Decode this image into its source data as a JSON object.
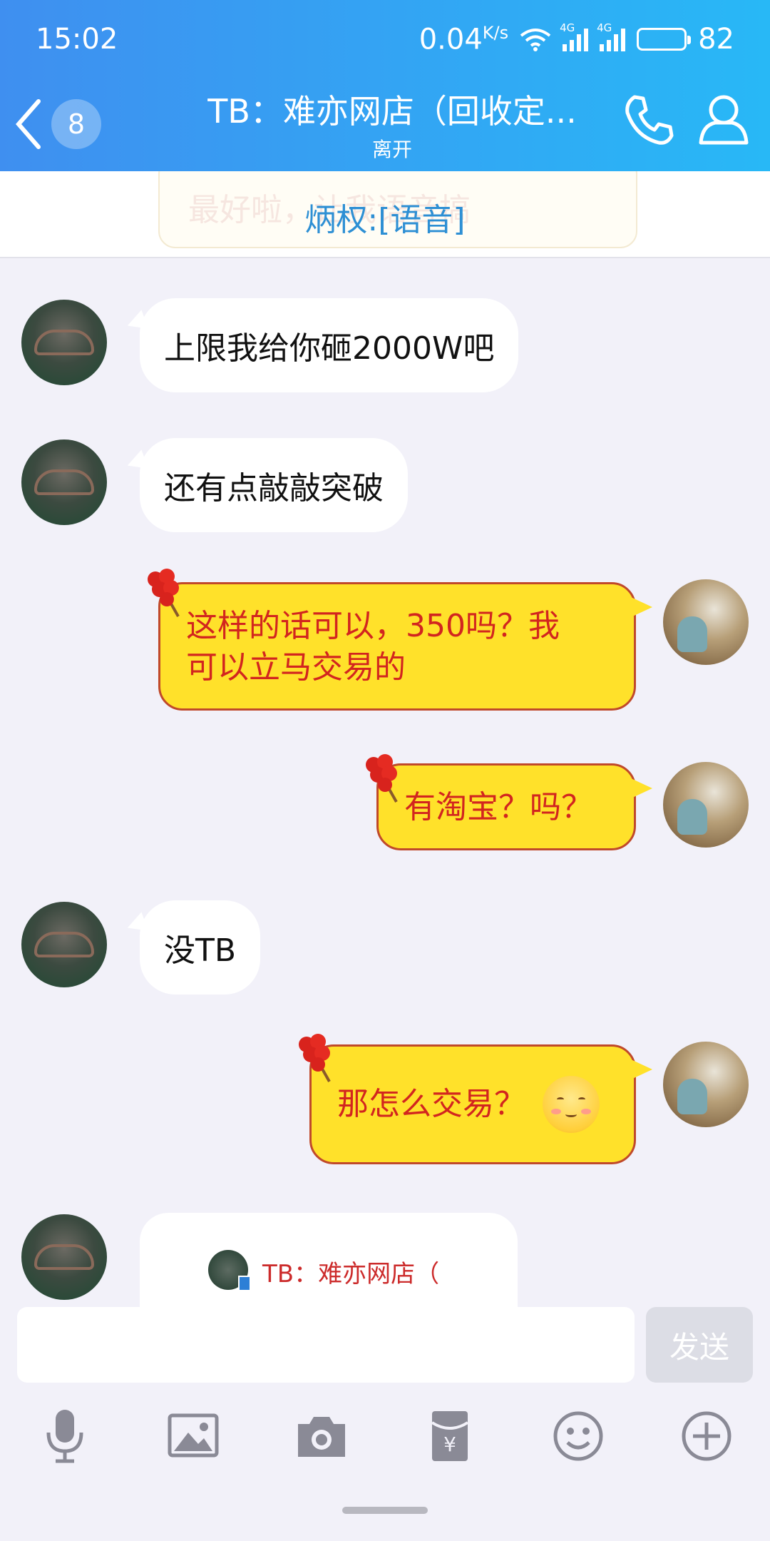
{
  "status_bar": {
    "time": "15:02",
    "net_speed": "0.04",
    "net_unit": "K/s",
    "signal1_label": "4G",
    "signal2_label": "4G",
    "battery": "82"
  },
  "header": {
    "unread_count": "8",
    "title": "TB：难亦网店（回收定...",
    "status": "离开",
    "icons": [
      "back-chevron-icon",
      "phone-icon",
      "profile-icon"
    ]
  },
  "pinned": {
    "text": "炳权:[语音]",
    "ghost_text": "最好啦，让我语音搞"
  },
  "messages": [
    {
      "side": "them",
      "text": "上限我给你砸2000W吧"
    },
    {
      "side": "them",
      "text": "还有点敲敲突破"
    },
    {
      "side": "me",
      "line1": "这样的话可以，350吗？我",
      "line2": "可以立马交易的"
    },
    {
      "side": "me",
      "text": "有淘宝？吗？"
    },
    {
      "side": "them",
      "text": "没TB"
    },
    {
      "side": "me",
      "text": "那怎么交易？",
      "emoji": "smile-blush-emoji"
    },
    {
      "side": "them",
      "card_text": "TB：难亦网店（"
    }
  ],
  "input": {
    "placeholder": "",
    "send_label": "发送"
  },
  "toolbar": {
    "icons": [
      "microphone-icon",
      "image-icon",
      "camera-icon",
      "red-packet-icon",
      "emoji-icon",
      "plus-icon"
    ]
  },
  "colors": {
    "header_start": "#3f8ff0",
    "header_end": "#28b8f6",
    "my_bubble": "#ffe12a",
    "my_text": "#d2251f",
    "pinned_text": "#2d8fd4"
  }
}
